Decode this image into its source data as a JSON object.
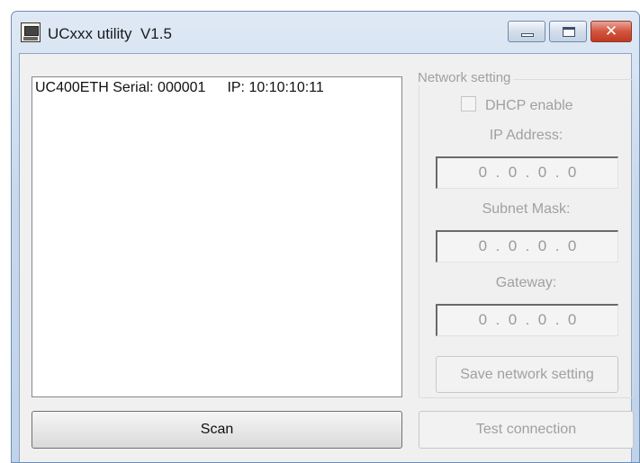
{
  "window": {
    "title": "UCxxx utility  V1.5",
    "controls": {
      "minimize": "minimize",
      "maximize": "maximize",
      "close": "✕"
    }
  },
  "device_list": {
    "items": [
      {
        "name": "UC400ETH Serial: 000001",
        "ip": "IP: 10:10:10:11"
      }
    ]
  },
  "network_setting": {
    "legend": "Network setting",
    "dhcp_label": "DHCP enable",
    "dhcp_checked": false,
    "ip_label": "IP Address:",
    "ip_value": "0  .  0  .  0  .  0",
    "subnet_label": "Subnet Mask:",
    "subnet_value": "0  .  0  .  0  .  0",
    "gateway_label": "Gateway:",
    "gateway_value": "0  .  0  .  0  .  0",
    "save_label": "Save network setting"
  },
  "actions": {
    "scan_label": "Scan",
    "test_label": "Test connection"
  },
  "colors": {
    "titlebar": "#c9d9ec",
    "close_button": "#c23a22",
    "disabled_text": "#a0a0a0"
  }
}
